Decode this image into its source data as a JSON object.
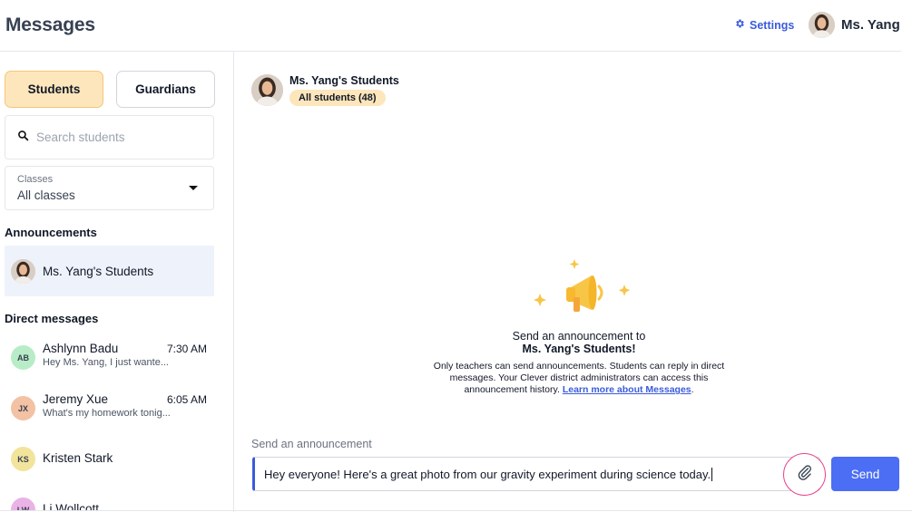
{
  "header": {
    "title": "Messages",
    "settings_label": "Settings",
    "user_name": "Ms. Yang"
  },
  "sidebar": {
    "tabs": [
      {
        "label": "Students",
        "active": true
      },
      {
        "label": "Guardians",
        "active": false
      }
    ],
    "search": {
      "placeholder": "Search students",
      "value": ""
    },
    "classes": {
      "label": "Classes",
      "value": "All classes"
    },
    "announcements_title": "Announcements",
    "announcement_item": "Ms. Yang's Students",
    "direct_messages_title": "Direct messages",
    "direct_messages": [
      {
        "initials": "AB",
        "name": "Ashlynn Badu",
        "time": "7:30 AM",
        "preview": "Hey Ms. Yang, I just wante...",
        "color": "#b7ecc7"
      },
      {
        "initials": "JX",
        "name": "Jeremy Xue",
        "time": "6:05 AM",
        "preview": "What's my homework tonig...",
        "color": "#f3c1a4"
      },
      {
        "initials": "KS",
        "name": "Kristen Stark",
        "time": "",
        "preview": "",
        "color": "#f2e49c"
      },
      {
        "initials": "LW",
        "name": "Li Wollcott",
        "time": "",
        "preview": "",
        "color": "#e9b3e6"
      }
    ]
  },
  "thread": {
    "title": "Ms. Yang's Students",
    "badge": "All students (48)"
  },
  "empty_state": {
    "line1": "Send an announcement to",
    "line2": "Ms. Yang's Students!",
    "description": "Only teachers can send announcements. Students can reply in direct messages. Your Clever district administrators can access this announcement history.",
    "link": "Learn more about Messages",
    "link_suffix": "."
  },
  "composer": {
    "label": "Send an announcement",
    "value": "Hey everyone! Here's a great photo from our gravity experiment during science today.",
    "send_label": "Send"
  },
  "colors": {
    "accent": "#4b6ef5",
    "link": "#3b5bdb",
    "tab_active": "#fde6bb",
    "attach_ring": "#e6418a",
    "illustration": "#f8c646"
  }
}
